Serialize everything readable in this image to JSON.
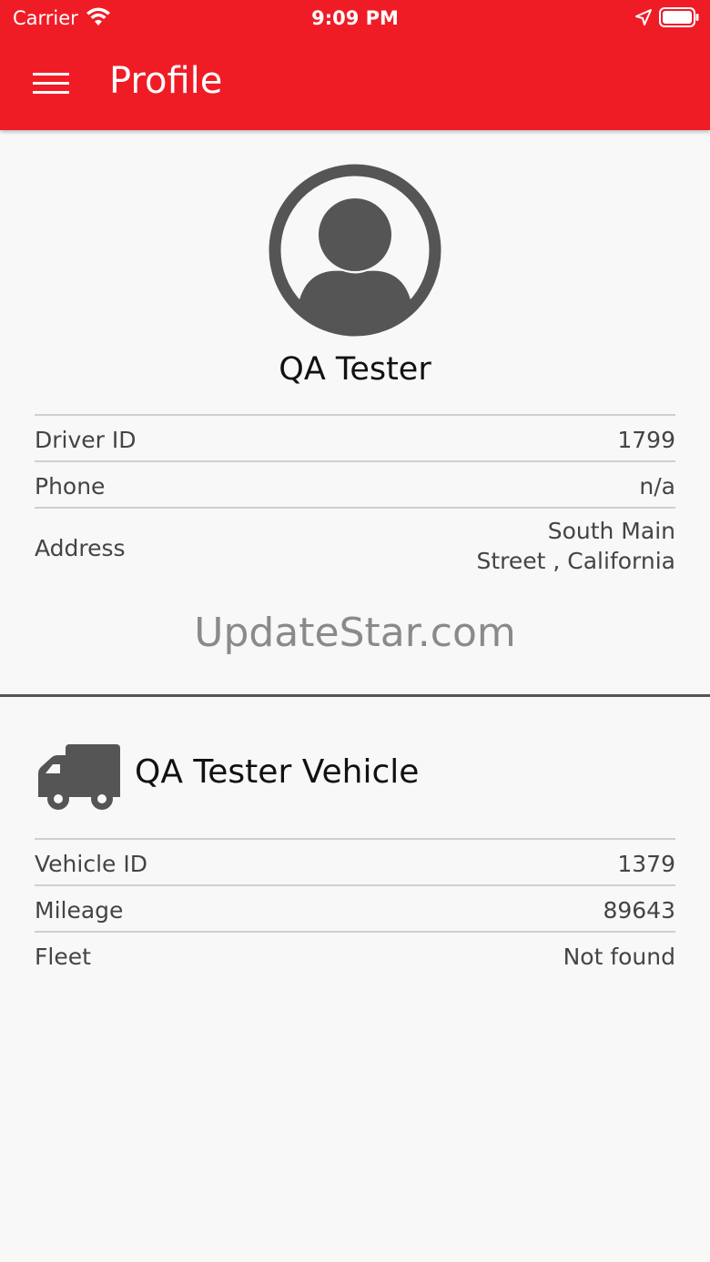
{
  "status_bar": {
    "carrier": "Carrier",
    "time": "9:09 PM",
    "icons": [
      "wifi-icon",
      "location-arrow-icon",
      "battery-icon"
    ]
  },
  "header": {
    "title": "Profile",
    "menu_icon": "hamburger-menu-icon",
    "background_color": "#ef1c26"
  },
  "driver": {
    "name": "QA Tester",
    "avatar_icon": "user-avatar-icon",
    "fields": [
      {
        "label": "Driver ID",
        "value": "1799"
      },
      {
        "label": "Phone",
        "value": "n/a"
      },
      {
        "label": "Address",
        "value_line1": "South Main",
        "value_line2": "Street , California"
      }
    ]
  },
  "watermark": "UpdateStar.com",
  "vehicle": {
    "title": "QA Tester Vehicle",
    "icon": "truck-icon",
    "fields": [
      {
        "label": "Vehicle ID",
        "value": "1379"
      },
      {
        "label": "Mileage",
        "value": "89643"
      },
      {
        "label": "Fleet",
        "value": "Not found"
      }
    ]
  }
}
